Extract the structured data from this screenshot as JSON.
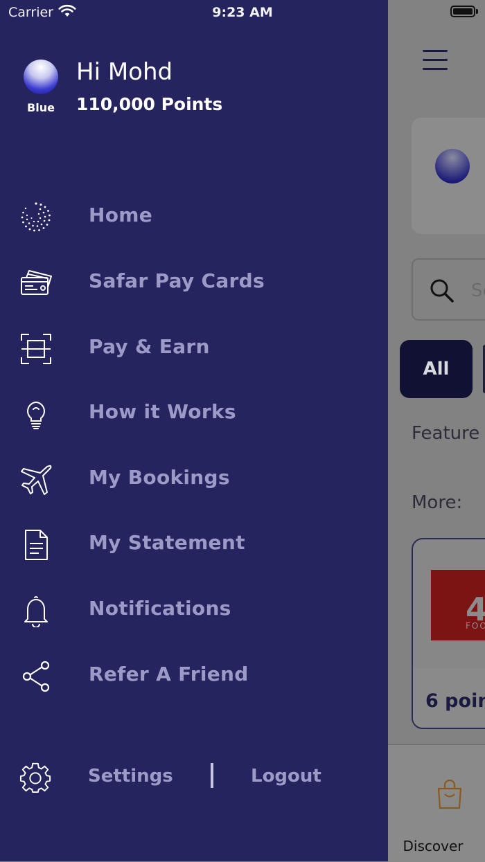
{
  "status_bar": {
    "carrier": "Carrier",
    "time": "9:23 AM"
  },
  "drawer": {
    "tier": "Blue",
    "greeting": "Hi Mohd",
    "points": "110,000 Points",
    "menu": [
      {
        "label": "Home",
        "icon": "dotted-spiral-icon"
      },
      {
        "label": "Safar Pay Cards",
        "icon": "cards-icon"
      },
      {
        "label": "Pay & Earn",
        "icon": "scan-icon"
      },
      {
        "label": "How it Works",
        "icon": "lightbulb-icon"
      },
      {
        "label": "My Bookings",
        "icon": "airplane-icon"
      },
      {
        "label": "My Statement",
        "icon": "document-icon"
      },
      {
        "label": "Notifications",
        "icon": "bell-icon"
      },
      {
        "label": "Refer A Friend",
        "icon": "share-icon"
      }
    ],
    "settings_label": "Settings",
    "logout_label": "Logout",
    "colors": {
      "drawer_bg": "#25245e",
      "menu_text": "#9c9bc8",
      "text_white": "#ffffff"
    }
  },
  "background": {
    "search_placeholder": "Se",
    "chip_all": "All",
    "featured_label": "Feature",
    "more_label": "More:",
    "offer_logo": "4",
    "offer_logo_sub": "FOO",
    "offer_points": "6 poin",
    "tab_discover": "Discover"
  }
}
